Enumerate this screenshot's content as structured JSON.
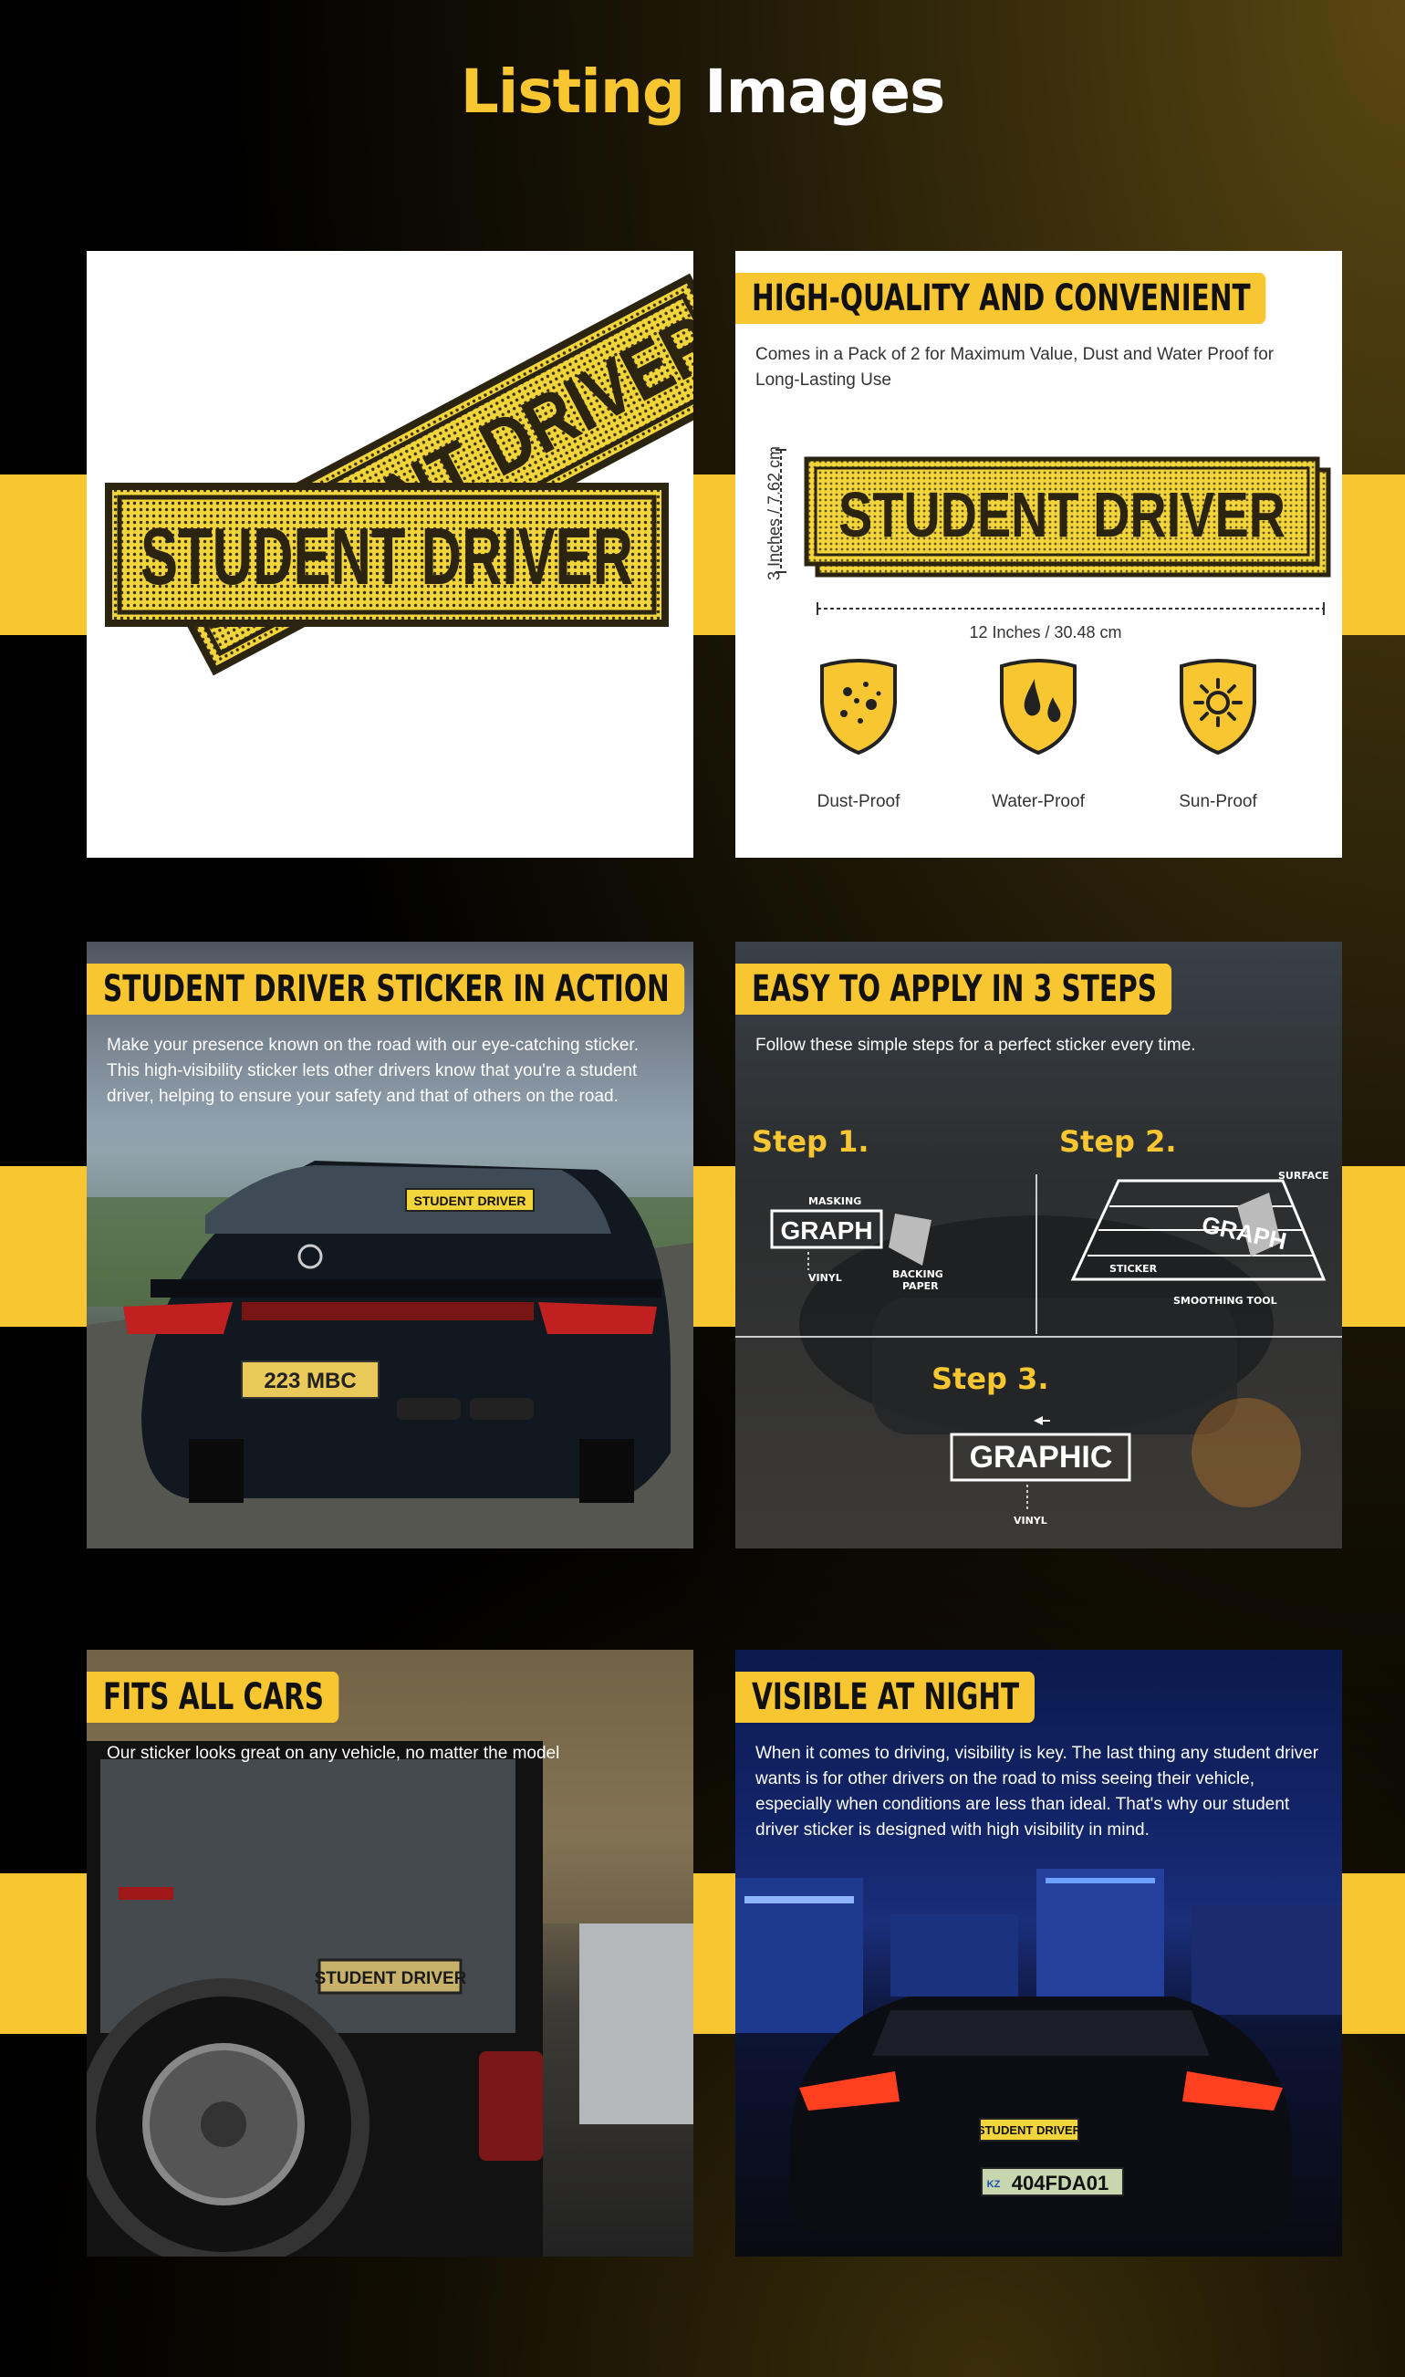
{
  "title": {
    "part1": "Listing",
    "part2": "Images"
  },
  "colors": {
    "accent": "#f7c631",
    "background": "#000000"
  },
  "card1": {
    "sticker_text": "STUDENT DRIVER"
  },
  "card2": {
    "banner": "HIGH-QUALITY AND CONVENIENT",
    "desc": "Comes in a Pack of 2 for Maximum Value, Dust and Water Proof for Long-Lasting Use",
    "sticker_text": "STUDENT DRIVER",
    "height_label": "3 Inches / 7.62 cm",
    "width_label": "12 Inches / 30.48 cm",
    "features": [
      {
        "label": "Dust-Proof",
        "icon": "dust-shield-icon"
      },
      {
        "label": "Water-Proof",
        "icon": "water-shield-icon"
      },
      {
        "label": "Sun-Proof",
        "icon": "sun-shield-icon"
      }
    ]
  },
  "card3": {
    "banner": "STUDENT DRIVER STICKER IN ACTION",
    "desc": "Make your presence known on the road with our eye-catching sticker. This high-visibility sticker lets other drivers know that you're a student driver, helping to ensure your safety and that of others on the road.",
    "sticker_text": "STUDENT DRIVER",
    "plate": "223 MBC"
  },
  "card4": {
    "banner": "EASY TO APPLY IN 3 STEPS",
    "desc": "Follow these simple steps for a perfect sticker every time.",
    "step1": "Step 1.",
    "step2": "Step 2.",
    "step3": "Step 3.",
    "graphic": "GRAPHIC",
    "graph_partial": "GRAPH",
    "masking": "MASKING",
    "vinyl": "VINYL",
    "backing": "BACKING",
    "paper": "PAPER",
    "surface": "SURFACE",
    "sticker": "STICKER",
    "smoothing": "SMOOTHING TOOL"
  },
  "card5": {
    "banner": "FITS ALL CARS",
    "desc": "Our sticker looks great on any vehicle, no matter the model",
    "sticker_text": "STUDENT DRIVER"
  },
  "card6": {
    "banner": "VISIBLE AT NIGHT",
    "desc": "When it comes to driving, visibility is key. The last thing any student driver wants is for other drivers on the road to miss seeing their vehicle, especially when conditions are less than ideal. That's why our student driver sticker is designed with high visibility in mind.",
    "sticker_text": "STUDENT DRIVER",
    "plate_prefix": "KZ",
    "plate": "404FDA01"
  }
}
